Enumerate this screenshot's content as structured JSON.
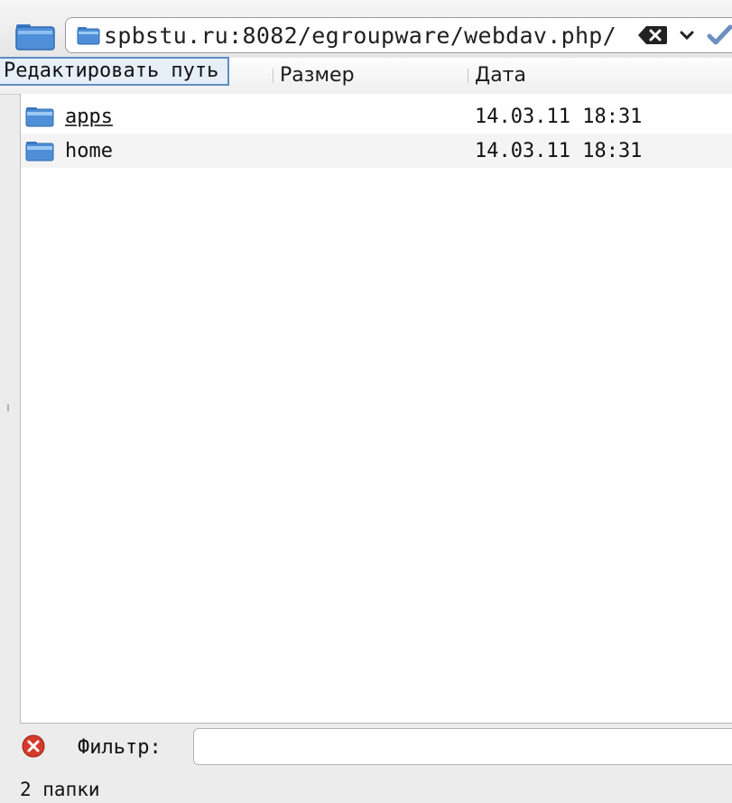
{
  "urlbar": {
    "url": "spbstu.ru:8082/egroupware/webdav.php/",
    "places_icon": "folder-icon",
    "field_icon": "folder-icon",
    "clear_icon": "backspace-clear-icon",
    "dropdown_icon": "chevron-down-icon",
    "go_icon": "checkmark-icon"
  },
  "tooltip": "Редактировать путь",
  "columns": {
    "size": "Размер",
    "date": "Дата"
  },
  "files": [
    {
      "name": "apps",
      "date": "14.03.11 18:31",
      "icon": "folder-icon"
    },
    {
      "name": "home",
      "date": "14.03.11 18:31",
      "icon": "folder-icon"
    }
  ],
  "filter": {
    "label": "Фильтр:",
    "value": "",
    "clear_icon": "clear-red-icon"
  },
  "status": "2 папки",
  "colors": {
    "folder_blue": "#4f8fd8",
    "clear_red": "#d63a2a",
    "tooltip_border": "#5f8cc4",
    "check_blue": "#6a8fc0"
  }
}
